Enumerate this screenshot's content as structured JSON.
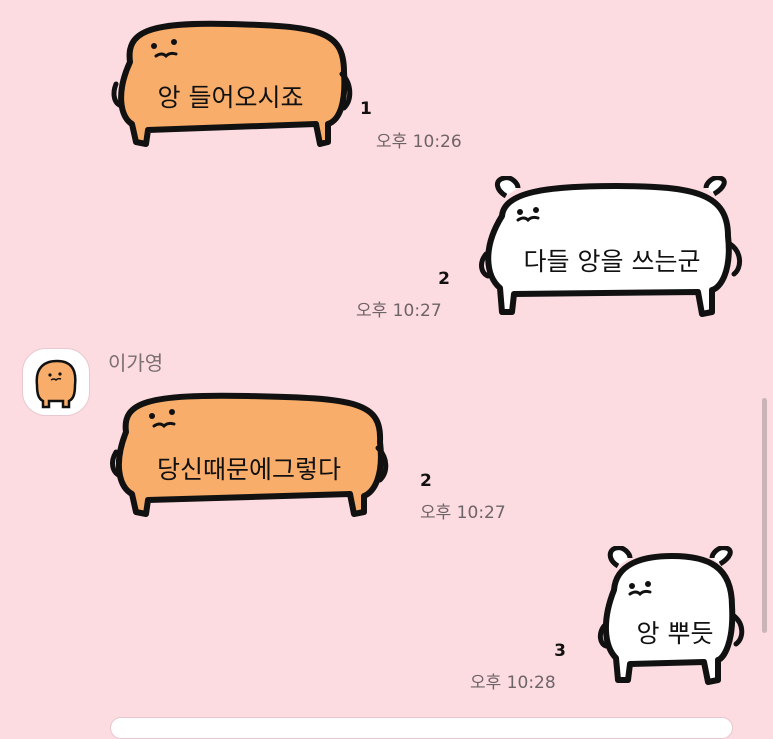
{
  "messages": [
    {
      "id": "m1",
      "side": "left",
      "text": "앙 들어오시죠",
      "unread": "1",
      "time": "오후 10:26"
    },
    {
      "id": "m2",
      "side": "right",
      "text": "다들 앙을 쓰는군",
      "unread": "2",
      "time": "오후 10:27"
    },
    {
      "id": "m3",
      "side": "left",
      "sender": "이가영",
      "text": "당신때문에그렇다",
      "unread": "2",
      "time": "오후 10:27"
    },
    {
      "id": "m4",
      "side": "right",
      "text": "앙 뿌듯",
      "unread": "3",
      "time": "오후 10:28"
    }
  ],
  "colors": {
    "background": "#fcdbe1",
    "orange_bubble": "#f8ad6a",
    "white_bubble": "#ffffff",
    "outline": "#111111",
    "time": "#6d6468"
  },
  "icons": {
    "avatar": "orange-creature-avatar-icon"
  }
}
